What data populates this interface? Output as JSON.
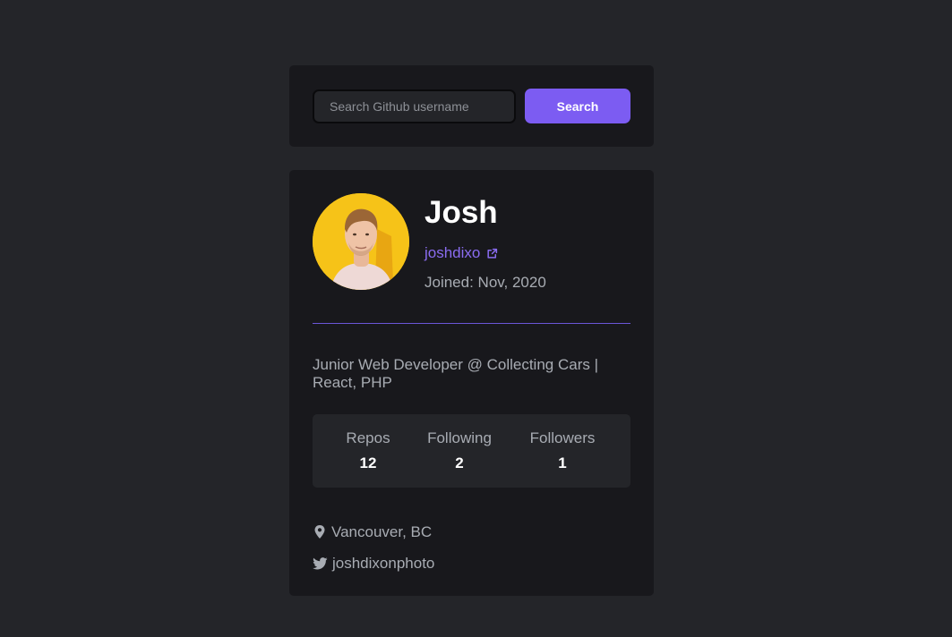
{
  "search": {
    "placeholder": "Search Github username",
    "value": "",
    "button_label": "Search"
  },
  "profile": {
    "name": "Josh",
    "login": "joshdixo",
    "joined": "Joined: Nov, 2020",
    "bio": "Junior Web Developer @ Collecting Cars | React, PHP",
    "stats": [
      {
        "label": "Repos",
        "value": "12"
      },
      {
        "label": "Following",
        "value": "2"
      },
      {
        "label": "Followers",
        "value": "1"
      }
    ],
    "location": "Vancouver, BC",
    "twitter": "joshdixonphoto"
  },
  "icons": {
    "external_link": "external-link-icon",
    "location": "map-pin-icon",
    "twitter": "twitter-icon"
  },
  "colors": {
    "background": "#242529",
    "card": "#18181c",
    "accent": "#7c5cf2",
    "link": "#8a6cf0",
    "muted_text": "#a8acb3",
    "avatar_background": "#f6c318"
  }
}
